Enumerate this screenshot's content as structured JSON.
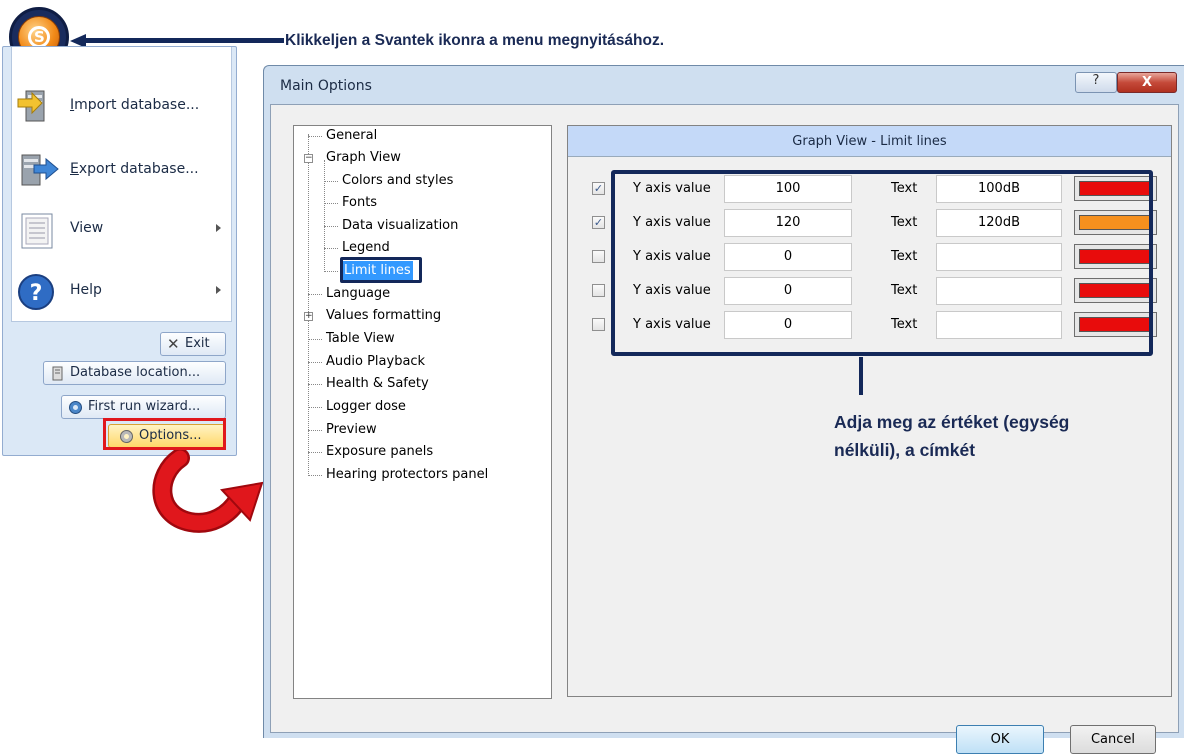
{
  "annotations": {
    "top_callout": "Klikkeljen a Svantek ikonra a menu megnyitásához.",
    "note_line1": "Adja meg az értéket (egység",
    "note_line2": "nélküli), a címkét",
    "highlight_color": "#e0171c",
    "navy_color": "#13285a"
  },
  "orb": {
    "icon": "svantek-logo-icon",
    "letter": "S"
  },
  "app_menu": {
    "items": [
      {
        "label_u": "I",
        "label_rest": "mport database...",
        "icon": "import-database-icon"
      },
      {
        "label_u": "E",
        "label_rest": "xport database...",
        "icon": "export-database-icon"
      },
      {
        "label": "View",
        "icon": "view-document-icon",
        "submenu": true
      },
      {
        "label": "Help",
        "icon": "help-icon",
        "submenu": true
      }
    ],
    "buttons": {
      "exit": "Exit",
      "database_location": "Database location...",
      "first_run_wizard": "First run wizard...",
      "options": "Options..."
    }
  },
  "dialog": {
    "title": "Main Options",
    "help_glyph": "?",
    "close_glyph": "X",
    "tree": [
      {
        "label": "General"
      },
      {
        "label": "Graph View",
        "expander": "−"
      },
      {
        "label": "Colors and styles"
      },
      {
        "label": "Fonts"
      },
      {
        "label": "Data visualization"
      },
      {
        "label": "Legend"
      },
      {
        "label": "Limit lines",
        "selected": true
      },
      {
        "label": "Language"
      },
      {
        "label": "Values formatting",
        "expander": "+"
      },
      {
        "label": "Table View"
      },
      {
        "label": "Audio Playback"
      },
      {
        "label": "Health & Safety"
      },
      {
        "label": "Logger dose"
      },
      {
        "label": "Preview"
      },
      {
        "label": "Exposure panels"
      },
      {
        "label": "Hearing protectors panel"
      }
    ],
    "panel_header": "Graph View - Limit lines",
    "y_label": "Y axis value",
    "text_label": "Text",
    "rows": [
      {
        "checked": true,
        "check_glyph": "✓",
        "y_value": "100",
        "text": "100dB",
        "color": "#e80c0c"
      },
      {
        "checked": true,
        "check_glyph": "✓",
        "y_value": "120",
        "text": "120dB",
        "color": "#f5901e"
      },
      {
        "checked": false,
        "check_glyph": "",
        "y_value": "0",
        "text": "",
        "color": "#e80c0c"
      },
      {
        "checked": false,
        "check_glyph": "",
        "y_value": "0",
        "text": "",
        "color": "#e80c0c"
      },
      {
        "checked": false,
        "check_glyph": "",
        "y_value": "0",
        "text": "",
        "color": "#e80c0c"
      }
    ],
    "ok": "OK",
    "cancel": "Cancel"
  }
}
